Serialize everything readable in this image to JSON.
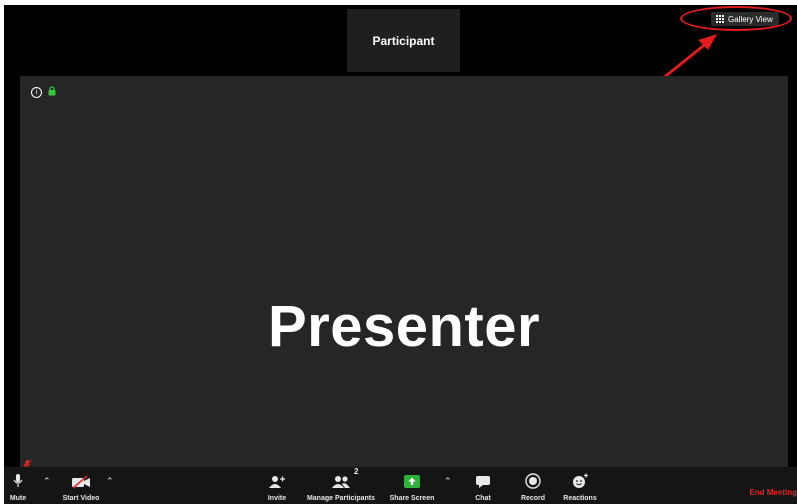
{
  "participant_tile": {
    "name": "Participant"
  },
  "gallery_view": {
    "label": "Gallery View",
    "icon": "grid-icon"
  },
  "presenter": {
    "name": "Presenter"
  },
  "toolbar": {
    "mute_label": "Mute",
    "start_video_label": "Start Video",
    "invite_label": "Invite",
    "manage_participants_label": "Manage Participants",
    "participant_count": "2",
    "share_screen_label": "Share Screen",
    "chat_label": "Chat",
    "record_label": "Record",
    "reactions_label": "Reactions",
    "end_meeting_label": "End Meeting"
  },
  "colors": {
    "highlight": "#e21b1b",
    "share_green": "#2bb33a",
    "lock_green": "#31c93b",
    "end_meeting_red": "#e02828"
  }
}
